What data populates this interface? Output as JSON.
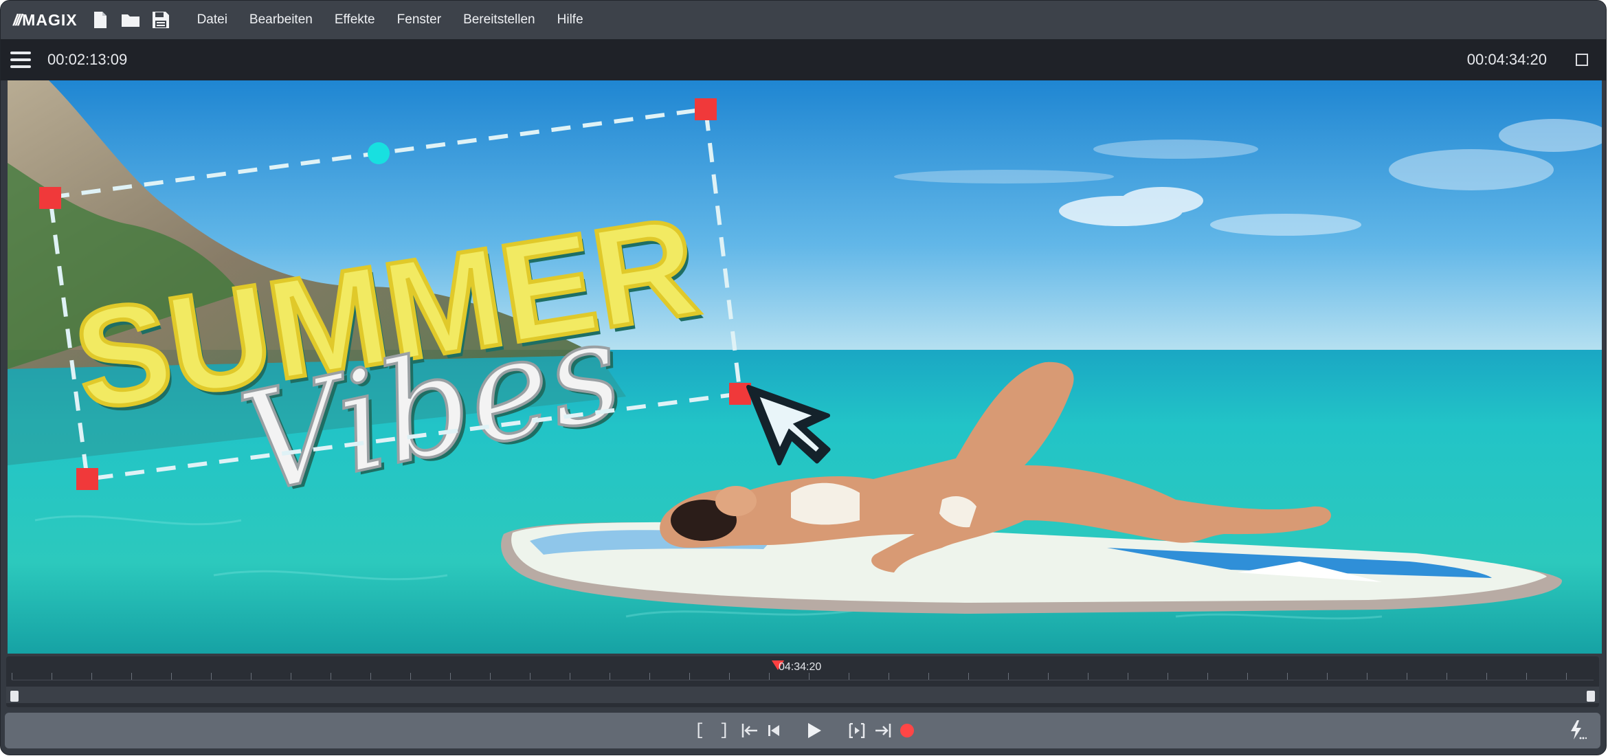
{
  "app": {
    "brand_slashes": "///",
    "brand": "MAGIX"
  },
  "menu": [
    {
      "label": "Datei"
    },
    {
      "label": "Bearbeiten"
    },
    {
      "label": "Effekte"
    },
    {
      "label": "Fenster"
    },
    {
      "label": "Bereitstellen"
    },
    {
      "label": "Hilfe"
    }
  ],
  "toolbar": {
    "current_time": "00:02:13:09",
    "total_time": "00:04:34:20"
  },
  "preview": {
    "title_line1": "SUMMER",
    "title_line2": "Vibes"
  },
  "timeline": {
    "playhead_label": "04:34:20"
  },
  "transport": {
    "mark_in": "[",
    "mark_out": "]"
  },
  "colors": {
    "handle": "#f0393a",
    "rotate_handle": "#18e0e0",
    "record": "#ff4646"
  },
  "icons": [
    "new-file-icon",
    "open-folder-icon",
    "save-icon",
    "hamburger-icon",
    "fullscreen-icon",
    "jump-start-icon",
    "prev-marker-icon",
    "play-icon",
    "next-marker-icon",
    "jump-end-icon",
    "record-icon",
    "lightning-icon",
    "mouse-cursor-icon"
  ]
}
